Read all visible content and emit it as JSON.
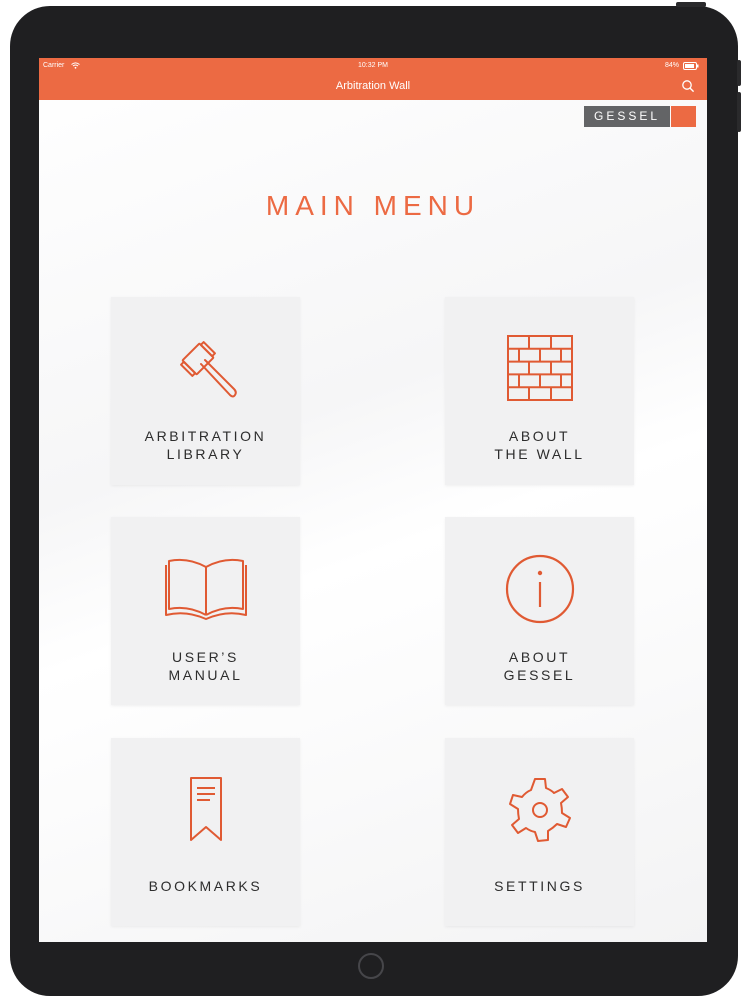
{
  "status_bar": {
    "carrier": "Carrier",
    "time": "10:32 PM",
    "battery": "84%"
  },
  "nav_bar": {
    "title": "Arbitration Wall",
    "search_icon": "search-icon"
  },
  "brand": {
    "logo_text": "GESSEL",
    "accent_color": "#ec6a43"
  },
  "main": {
    "heading": "MAIN MENU",
    "tiles": [
      {
        "line1": "ARBITRATION",
        "line2": "LIBRARY",
        "icon": "gavel-icon"
      },
      {
        "line1": "ABOUT",
        "line2": "THE WALL",
        "icon": "brick-wall-icon"
      },
      {
        "line1": "USER’S",
        "line2": "MANUAL",
        "icon": "open-book-icon"
      },
      {
        "line1": "ABOUT",
        "line2": "GESSEL",
        "icon": "info-icon"
      },
      {
        "line1": "BOOKMARKS",
        "line2": "",
        "icon": "bookmark-icon"
      },
      {
        "line1": "SETTINGS",
        "line2": "",
        "icon": "gear-icon"
      }
    ]
  }
}
